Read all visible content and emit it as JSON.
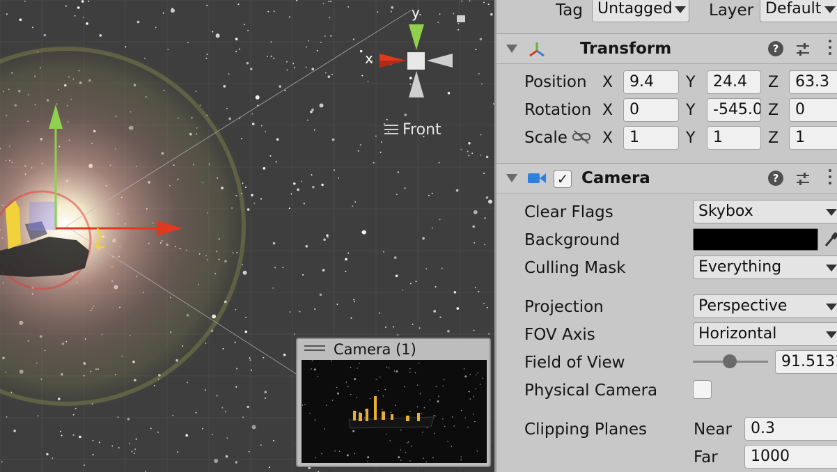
{
  "scene": {
    "gizmo": {
      "y_label": "y",
      "x_label": "x",
      "view_label": "Front"
    },
    "camera_preview": {
      "title": "Camera (1)"
    }
  },
  "inspector": {
    "tag_label": "Tag",
    "tag_value": "Untagged",
    "layer_label": "Layer",
    "layer_value": "Default",
    "transform": {
      "title": "Transform",
      "position": {
        "label": "Position",
        "x": "9.4",
        "y": "24.4",
        "z": "63.3"
      },
      "rotation": {
        "label": "Rotation",
        "x": "0",
        "y": "-545.0",
        "z": "0"
      },
      "scale": {
        "label": "Scale",
        "x": "1",
        "y": "1",
        "z": "1"
      }
    },
    "camera": {
      "title": "Camera",
      "enabled": true,
      "clear_flags": {
        "label": "Clear Flags",
        "value": "Skybox"
      },
      "background": {
        "label": "Background",
        "color": "#000000"
      },
      "culling_mask": {
        "label": "Culling Mask",
        "value": "Everything"
      },
      "projection": {
        "label": "Projection",
        "value": "Perspective"
      },
      "fov_axis": {
        "label": "FOV Axis",
        "value": "Horizontal"
      },
      "field_of_view": {
        "label": "Field of View",
        "value": "91.5131"
      },
      "physical_camera": {
        "label": "Physical Camera",
        "checked": false
      },
      "clipping_planes": {
        "label": "Clipping Planes",
        "near_label": "Near",
        "near": "0.3",
        "far_label": "Far",
        "far": "1000"
      }
    },
    "axis_labels": {
      "x": "X",
      "y": "Y",
      "z": "Z"
    }
  },
  "colors": {
    "accent_x": "#e0391f",
    "accent_y": "#8fd14f",
    "accent_z": "#3a7bd5",
    "camera_icon": "#2f7fe0"
  }
}
